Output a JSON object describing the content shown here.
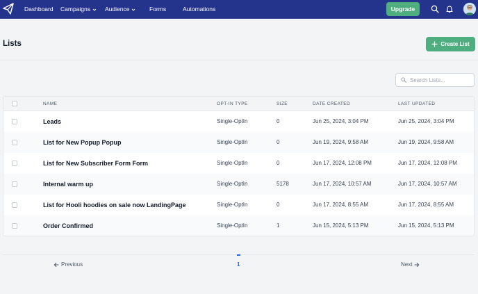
{
  "nav": {
    "items": [
      {
        "label": "Dashboard"
      },
      {
        "label": "Campaigns"
      },
      {
        "label": "Audience"
      },
      {
        "label": "Forms"
      },
      {
        "label": "Automations"
      }
    ],
    "upgrade_label": "Upgrade",
    "icons": [
      "paper-plane-icon",
      "search-icon",
      "bell-icon",
      "avatar"
    ]
  },
  "page": {
    "title": "Lists",
    "create_label": "Create List"
  },
  "search": {
    "placeholder": "Search Lists..."
  },
  "table": {
    "columns": [
      "NAME",
      "OPT-IN TYPE",
      "SIZE",
      "DATE CREATED",
      "LAST UPDATED"
    ],
    "rows": [
      {
        "name": "Leads",
        "optin": "Single-OptIn",
        "size": "0",
        "created": "Jun 25, 2024, 3:04 PM",
        "updated": "Jun 25, 2024, 3:04 PM"
      },
      {
        "name": "List for New Popup Popup",
        "optin": "Single-OptIn",
        "size": "0",
        "created": "Jun 19, 2024, 9:58 AM",
        "updated": "Jun 19, 2024, 9:58 AM"
      },
      {
        "name": "List for New Subscriber Form Form",
        "optin": "Single-OptIn",
        "size": "0",
        "created": "Jun 17, 2024, 12:08 PM",
        "updated": "Jun 17, 2024, 12:08 PM"
      },
      {
        "name": "Internal warm up",
        "optin": "Single-OptIn",
        "size": "5178",
        "created": "Jun 17, 2024, 10:57 AM",
        "updated": "Jun 17, 2024, 10:57 AM"
      },
      {
        "name": "List for Hooli hoodies on sale now LandingPage",
        "optin": "Single-OptIn",
        "size": "0",
        "created": "Jun 17, 2024, 8:55 AM",
        "updated": "Jun 17, 2024, 8:55 AM"
      },
      {
        "name": "Order Confirmed",
        "optin": "Single-OptIn",
        "size": "1",
        "created": "Jun 15, 2024, 5:13 PM",
        "updated": "Jun 15, 2024, 5:13 PM"
      }
    ]
  },
  "pagination": {
    "previous_label": "Previous",
    "next_label": "Next",
    "current_page": "1"
  },
  "colors": {
    "nav_bg": "#24338c",
    "accent_green": "#4fae7f",
    "page_active": "#2563eb"
  }
}
